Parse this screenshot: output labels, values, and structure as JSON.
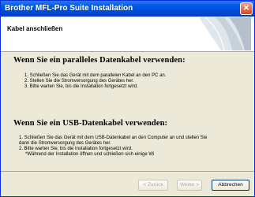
{
  "window": {
    "title": "Brother MFL-Pro Suite Installation",
    "close_glyph": "✕"
  },
  "header": {
    "title": "Kabel anschließen",
    "graphic_icon": "installer-graphic-icon"
  },
  "parallel": {
    "heading": "Wenn Sie ein paralleles Datenkabel verwenden:",
    "steps": [
      "1. Schließen Sie das Gerät mit dem parallelen Kabel an den PC an.",
      "2. Stellen Sie die Stromversorgung des Gerätes her.",
      "3. Bitte warten Sie, bis die Installation fortgesetzt wird."
    ]
  },
  "usb": {
    "heading": "Wenn Sie ein USB-Datenkabel verwenden:",
    "steps": [
      "1.  Schließen Sie das Gerät mit dem USB-Datenkabel an den Computer an und stellen Sie",
      "dann die Stromversorgung des Gerätes her.",
      "2. Bitte warten Sie, bis die Installation fortgesetzt wird.",
      "*Während der Installation öffnen und schließen sich einige Wi"
    ]
  },
  "buttons": {
    "back": "< Zurück",
    "next": "Weiter >",
    "cancel": "Abbrechen"
  },
  "colors": {
    "titlebar": "#0058e6",
    "dialog_bg": "#ece9d8",
    "header_bg": "#ffffff"
  }
}
